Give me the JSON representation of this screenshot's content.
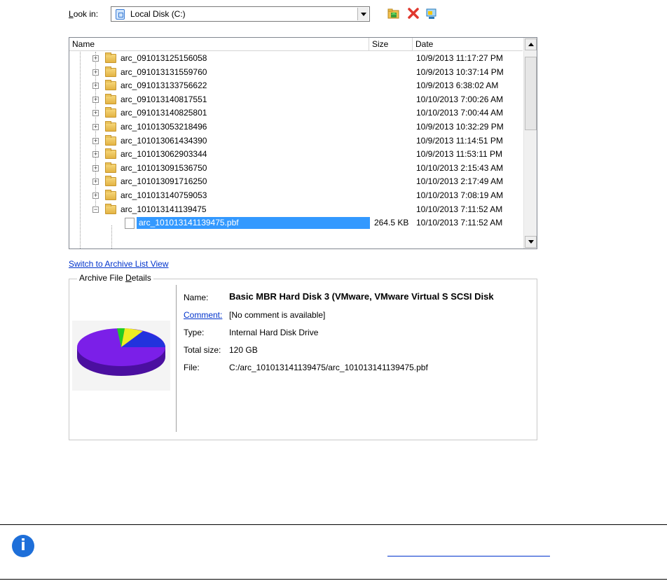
{
  "lookin": {
    "label_prefix": "L",
    "label_rest": "ook in:",
    "value": "Local Disk (C:)"
  },
  "toolbar": {
    "icons": [
      "up-folder-icon",
      "delete-icon",
      "view-icon"
    ]
  },
  "columns": {
    "name": "Name",
    "size": "Size",
    "date": "Date"
  },
  "rows": [
    {
      "name": "arc_091013125156058",
      "size": "",
      "date": "10/9/2013 11:17:27 PM"
    },
    {
      "name": "arc_091013131559760",
      "size": "",
      "date": "10/9/2013 10:37:14 PM"
    },
    {
      "name": "arc_091013133756622",
      "size": "",
      "date": "10/9/2013 6:38:02 AM"
    },
    {
      "name": "arc_091013140817551",
      "size": "",
      "date": "10/10/2013 7:00:26 AM"
    },
    {
      "name": "arc_091013140825801",
      "size": "",
      "date": "10/10/2013 7:00:44 AM"
    },
    {
      "name": "arc_101013053218496",
      "size": "",
      "date": "10/9/2013 10:32:29 PM"
    },
    {
      "name": "arc_101013061434390",
      "size": "",
      "date": "10/9/2013 11:14:51 PM"
    },
    {
      "name": "arc_101013062903344",
      "size": "",
      "date": "10/9/2013 11:53:11 PM"
    },
    {
      "name": "arc_101013091536750",
      "size": "",
      "date": "10/10/2013 2:15:43 AM"
    },
    {
      "name": "arc_101013091716250",
      "size": "",
      "date": "10/10/2013 2:17:49 AM"
    },
    {
      "name": "arc_101013140759053",
      "size": "",
      "date": "10/10/2013 7:08:19 AM"
    },
    {
      "name": "arc_101013141139475",
      "size": "",
      "date": "10/10/2013 7:11:52 AM"
    }
  ],
  "selected_file": {
    "name": "arc_101013141139475.pbf",
    "size": "264.5 KB",
    "date": "10/10/2013 7:11:52 AM"
  },
  "switch_link": "Switch to Archive List View",
  "details": {
    "title_prefix": "Archive File ",
    "title_underlined": "D",
    "title_rest": "etails",
    "name_label": "Name:",
    "name_value": "Basic MBR Hard Disk 3 (VMware, VMware Virtual S SCSI Disk",
    "comment_label": "Comment:",
    "comment_value": "[No comment is available]",
    "type_label": "Type:",
    "type_value": "Internal Hard Disk Drive",
    "size_label": "Total size:",
    "size_value": "120 GB",
    "file_label": "File:",
    "file_value": "C:/arc_101013141139475/arc_101013141139475.pbf"
  },
  "colors": {
    "selection": "#3399ff",
    "pie_main": "#7b1fe8",
    "pie_blue": "#2233dd",
    "pie_green": "#22cc22",
    "pie_yellow": "#eeee22",
    "info_icon": "#1e6fd9",
    "link": "#0033cc"
  },
  "info_icon_glyph": "i"
}
